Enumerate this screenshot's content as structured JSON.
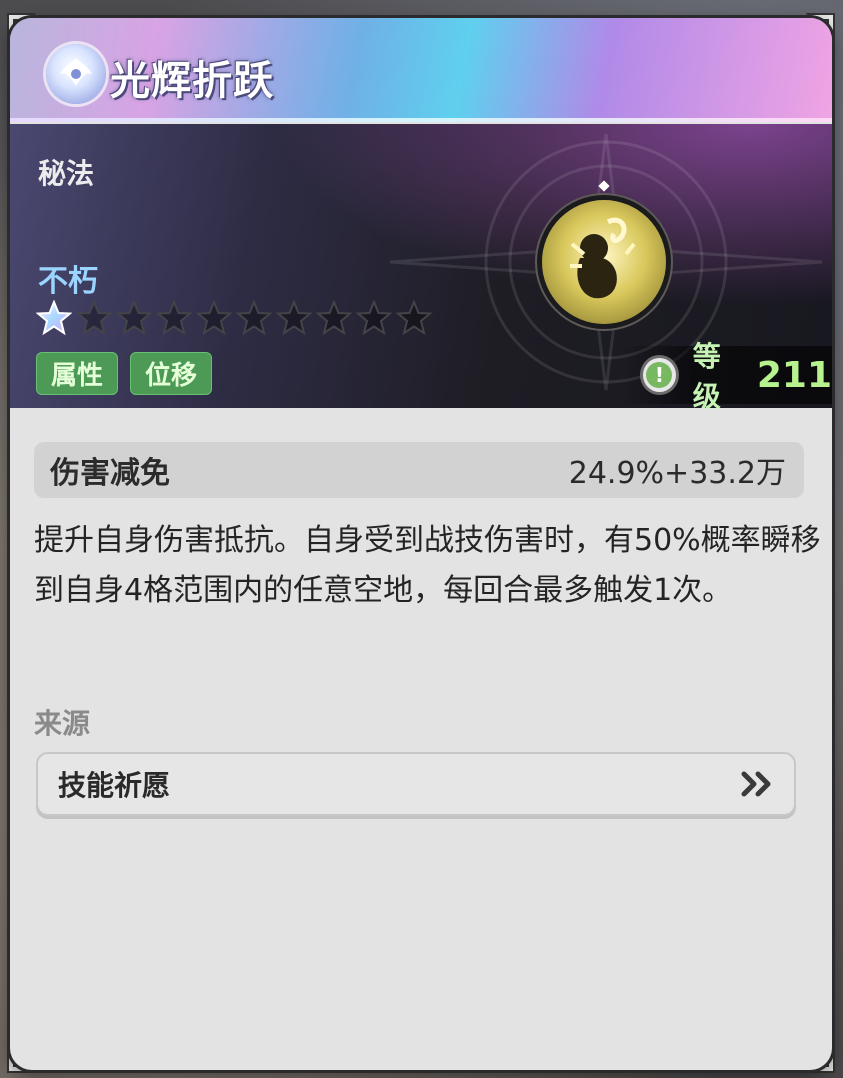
{
  "header": {
    "title": "光辉折跃"
  },
  "banner": {
    "category": "秘法",
    "subtitle": "不朽",
    "stars": {
      "filled": 1,
      "total": 10
    },
    "tags": [
      "属性",
      "位移"
    ],
    "level_label": "等级",
    "level_value": "211",
    "warning_symbol": "!"
  },
  "stat": {
    "name": "伤害减免",
    "value": "24.9%+33.2万"
  },
  "description": "提升自身伤害抵抗。自身受到战技伤害时，有50%概率瞬移到自身4格范围内的任意空地，每回合最多触发1次。",
  "source": {
    "label": "来源",
    "button_label": "技能祈愿"
  },
  "colors": {
    "accent_green": "#4c9a55",
    "subtitle_blue": "#9ad4ff",
    "level_green": "#b6f28e",
    "card_bg": "#e3e3e3"
  }
}
